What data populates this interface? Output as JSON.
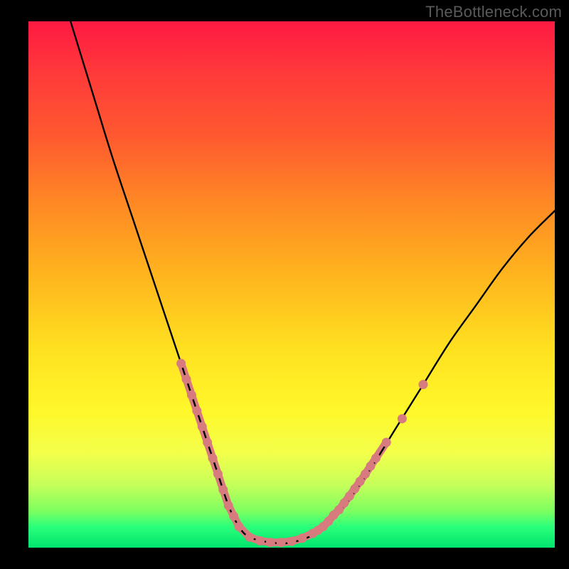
{
  "watermark": "TheBottleneck.com",
  "chart_data": {
    "type": "line",
    "title": "",
    "xlabel": "",
    "ylabel": "",
    "xlim": [
      0,
      100
    ],
    "ylim": [
      0,
      100
    ],
    "series": [
      {
        "name": "bottleneck-curve",
        "x": [
          8,
          12,
          16,
          20,
          24,
          28,
          30,
          32,
          34,
          36,
          38,
          40,
          42,
          46,
          50,
          55,
          60,
          65,
          70,
          75,
          80,
          85,
          90,
          95,
          100
        ],
        "y": [
          100,
          87,
          74,
          62,
          50,
          38,
          32,
          26,
          20,
          14,
          8,
          4,
          2,
          1,
          1,
          3,
          8,
          15,
          23,
          31,
          39,
          46,
          53,
          59,
          64
        ]
      }
    ],
    "markers": {
      "name": "highlight-points",
      "color": "#d77b7f",
      "points": [
        {
          "x": 29,
          "y": 35
        },
        {
          "x": 30,
          "y": 32
        },
        {
          "x": 31,
          "y": 29
        },
        {
          "x": 32,
          "y": 26
        },
        {
          "x": 33,
          "y": 23
        },
        {
          "x": 34,
          "y": 20
        },
        {
          "x": 35,
          "y": 17
        },
        {
          "x": 36,
          "y": 14
        },
        {
          "x": 37,
          "y": 11
        },
        {
          "x": 38,
          "y": 8
        },
        {
          "x": 39,
          "y": 6
        },
        {
          "x": 40,
          "y": 4
        },
        {
          "x": 42,
          "y": 2
        },
        {
          "x": 44,
          "y": 1.3
        },
        {
          "x": 46,
          "y": 1
        },
        {
          "x": 48,
          "y": 1
        },
        {
          "x": 50,
          "y": 1.2
        },
        {
          "x": 52,
          "y": 1.8
        },
        {
          "x": 54,
          "y": 2.7
        },
        {
          "x": 55,
          "y": 3.3
        },
        {
          "x": 56,
          "y": 4
        },
        {
          "x": 57,
          "y": 5
        },
        {
          "x": 58,
          "y": 6.2
        },
        {
          "x": 59,
          "y": 7.2
        },
        {
          "x": 60,
          "y": 8.5
        },
        {
          "x": 61,
          "y": 9.8
        },
        {
          "x": 62,
          "y": 11.2
        },
        {
          "x": 63,
          "y": 12.6
        },
        {
          "x": 64,
          "y": 14
        },
        {
          "x": 65,
          "y": 15.5
        },
        {
          "x": 66,
          "y": 17
        },
        {
          "x": 68,
          "y": 20
        },
        {
          "x": 71,
          "y": 24.5
        },
        {
          "x": 75,
          "y": 31
        }
      ]
    }
  }
}
